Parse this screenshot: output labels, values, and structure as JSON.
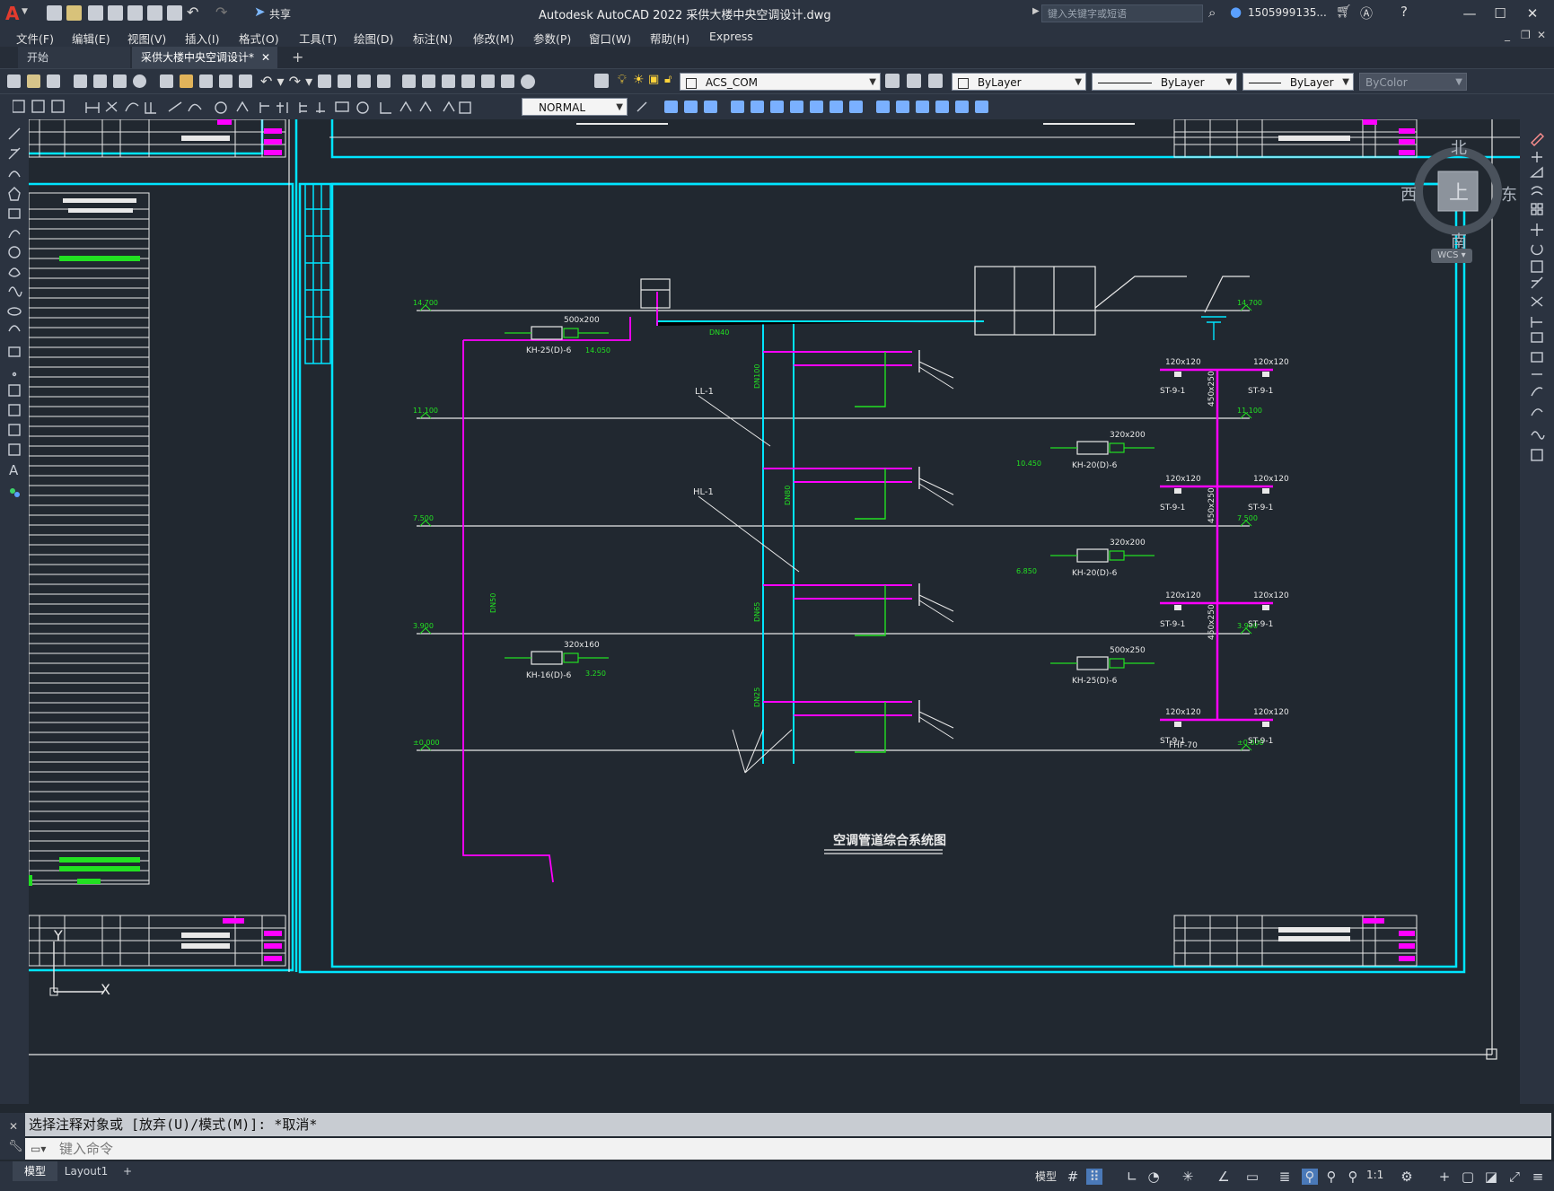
{
  "app": {
    "window_title": "Autodesk AutoCAD 2022    采供大楼中央空调设计.dwg",
    "share_label": "共享",
    "search_placeholder": "键入关键字或短语",
    "user_id": "1505999135...",
    "logo_letter": "A"
  },
  "menu": [
    "文件(F)",
    "编辑(E)",
    "视图(V)",
    "插入(I)",
    "格式(O)",
    "工具(T)",
    "绘图(D)",
    "标注(N)",
    "修改(M)",
    "参数(P)",
    "窗口(W)",
    "帮助(H)",
    "Express"
  ],
  "tabs": [
    {
      "label": "开始",
      "active": false
    },
    {
      "label": "采供大楼中央空调设计*",
      "active": true
    }
  ],
  "toolbar": {
    "layer_value": "ACS_COM",
    "color_value": "ByLayer",
    "linetype_value": "ByLayer",
    "lineweight_value": "ByLayer",
    "plotstyle_value": "ByColor",
    "textstyle_value": "NORMAL"
  },
  "viewcube": {
    "north": "北",
    "south": "南",
    "west": "西",
    "east": "东",
    "face": "上",
    "wcs": "WCS"
  },
  "ucs": {
    "x_label": "X",
    "y_label": "Y"
  },
  "drawing": {
    "title": "空调管道综合系统图",
    "levels": [
      "14.700",
      "11.100",
      "7.500",
      "3.900",
      "±0.000"
    ],
    "units": [
      {
        "label": "KH-25(D)-6",
        "size": "500x200"
      },
      {
        "label": "KH-20(D)-6",
        "size": "320x200"
      },
      {
        "label": "KH-20(D)-6",
        "size": "320x200"
      },
      {
        "label": "KH-16(D)-6",
        "size": "320x160"
      },
      {
        "label": "KH-25(D)-6",
        "size": "500x250"
      }
    ],
    "diffuser_label": "ST-9-1",
    "duct_size": "120x120",
    "riser_size": "450x250",
    "pipe_labels": [
      "DN100",
      "DN80",
      "DN65",
      "DN50",
      "DN40",
      "DN25"
    ],
    "riser_tags": [
      "LL-1",
      "HL-1"
    ],
    "damper_label": "FHF-70",
    "side_levels": [
      "14.050",
      "10.450",
      "6.850",
      "3.250"
    ]
  },
  "command": {
    "history": "选择注释对象或 [放弃(U)/模式(M)]: *取消*",
    "prompt_placeholder": "键入命令"
  },
  "status": {
    "layout_tabs": [
      "模型",
      "Layout1"
    ],
    "model_label": "模型",
    "scale": "1:1"
  },
  "colors": {
    "cyan": "#00e5ff",
    "magenta": "#ff00ff",
    "green": "#22e022",
    "white": "#e8e8e8",
    "canvas": "#212830"
  }
}
